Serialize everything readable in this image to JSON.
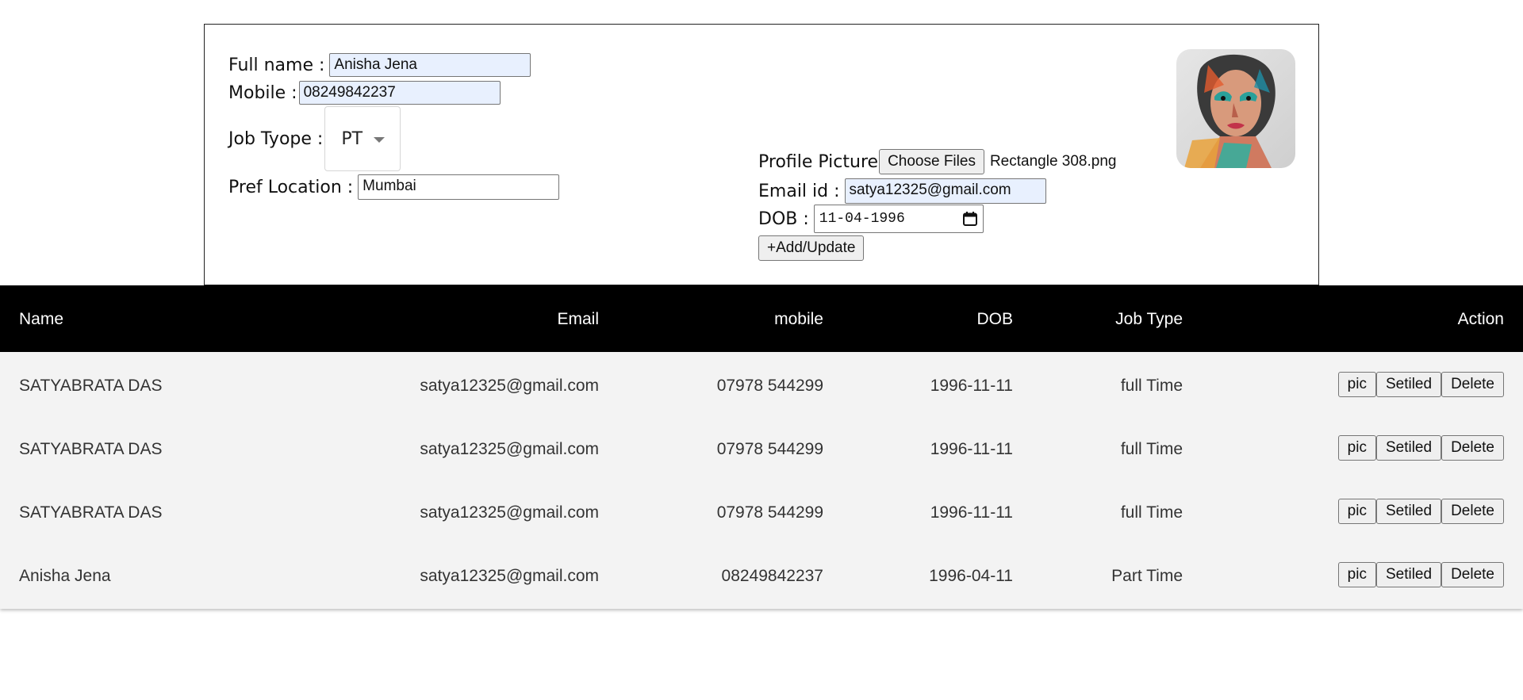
{
  "form": {
    "full_name_label": "Full name :",
    "full_name_value": "Anisha Jena",
    "mobile_label": "Mobile :",
    "mobile_value": "08249842237",
    "job_type_label": "Job Tyope :",
    "job_type_value": "PT",
    "pref_location_label": "Pref Location :",
    "pref_location_value": "Mumbai",
    "profile_picture_label": "Profile Picture",
    "choose_files_label": "Choose Files",
    "file_name": "Rectangle 308.png",
    "email_label": "Email id :",
    "email_value": "satya12325@gmail.com",
    "dob_label": "DOB :",
    "dob_value": "11-04-1996",
    "add_update_label": "+Add/Update"
  },
  "table": {
    "headers": [
      "Name",
      "Email",
      "mobile",
      "DOB",
      "Job Type",
      "Action"
    ],
    "rows": [
      {
        "name": "SATYABRATA DAS",
        "email": "satya12325@gmail.com",
        "mobile": "07978 544299",
        "dob": "1996-11-11",
        "job_type": "full Time"
      },
      {
        "name": "SATYABRATA DAS",
        "email": "satya12325@gmail.com",
        "mobile": "07978 544299",
        "dob": "1996-11-11",
        "job_type": "full Time"
      },
      {
        "name": "SATYABRATA DAS",
        "email": "satya12325@gmail.com",
        "mobile": "07978 544299",
        "dob": "1996-11-11",
        "job_type": "full Time"
      },
      {
        "name": "Anisha Jena",
        "email": "satya12325@gmail.com",
        "mobile": "08249842237",
        "dob": "1996-04-11",
        "job_type": "Part Time"
      }
    ],
    "action_labels": {
      "pic": "pic",
      "settled": "Setiled",
      "delete": "Delete"
    }
  },
  "icons": {
    "calendar": "calendar-icon",
    "select_caret": "chevron-down-icon",
    "avatar": "profile-picture-thumbnail"
  }
}
